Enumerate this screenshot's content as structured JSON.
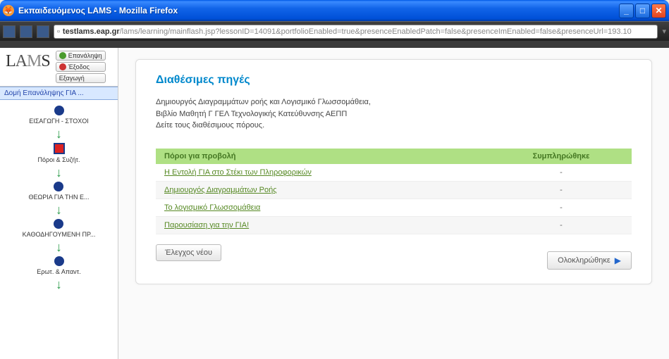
{
  "window": {
    "title": "Εκπαιδευόμενος LAMS - Mozilla Firefox"
  },
  "url": {
    "domain": "testlams.eap.gr",
    "path": "/lams/learning/mainflash.jsp?lessonID=14091&portfolioEnabled=true&presenceEnabledPatch=false&presenceImEnabled=false&presenceUrl=193.10"
  },
  "sidebar": {
    "logo": "LAMS",
    "buttons": {
      "resume": "Επανάληψη",
      "exit": "Έξοδος",
      "export": "Εξαγωγή"
    },
    "tab": "Δομή Επανάληψης ΓΙΑ ...",
    "nodes": [
      {
        "label": "ΕΙΣΑΓΩΓΗ - ΣΤΟΧΟΙ",
        "type": "circle"
      },
      {
        "label": "Πόροι & Συζήτ.",
        "type": "square"
      },
      {
        "label": "ΘΕΩΡΙΑ ΓΙΑ ΤΗΝ Ε...",
        "type": "circle"
      },
      {
        "label": "ΚΑΘΟΔΗΓΟΥΜΕΝΗ ΠΡ...",
        "type": "circle"
      },
      {
        "label": "Ερωτ. & Απαντ.",
        "type": "circle"
      }
    ]
  },
  "main": {
    "title": "Διαθέσιμες πηγές",
    "description_line1": "Δημιουργός Διαγραμμάτων ροής και Λογισμικό Γλωσσομάθεια,",
    "description_line2": "Βιβλίο Μαθητή Γ ΓΕΛ Τεχνολογικής Κατεύθυνσης ΑΕΠΠ",
    "description_line3": "Δείτε τους διαθέσιμους πόρους.",
    "table": {
      "header_resource": "Πόροι για προβολή",
      "header_completed": "Συμπληρώθηκε",
      "rows": [
        {
          "name": "Η Εντολή ΓΙΑ στο Στέκι των Πληροφορικών",
          "completed": "-"
        },
        {
          "name": "Δημιουργός Διαγραμμάτων Ροής",
          "completed": "-"
        },
        {
          "name": "Το λογισμικό Γλωσσομάθεια",
          "completed": "-"
        },
        {
          "name": "Παρουσίαση για την ΓΙΑ!",
          "completed": "-"
        }
      ]
    },
    "check_button": "Έλεγχος νέου",
    "complete_button": "Ολοκληρώθηκε"
  }
}
